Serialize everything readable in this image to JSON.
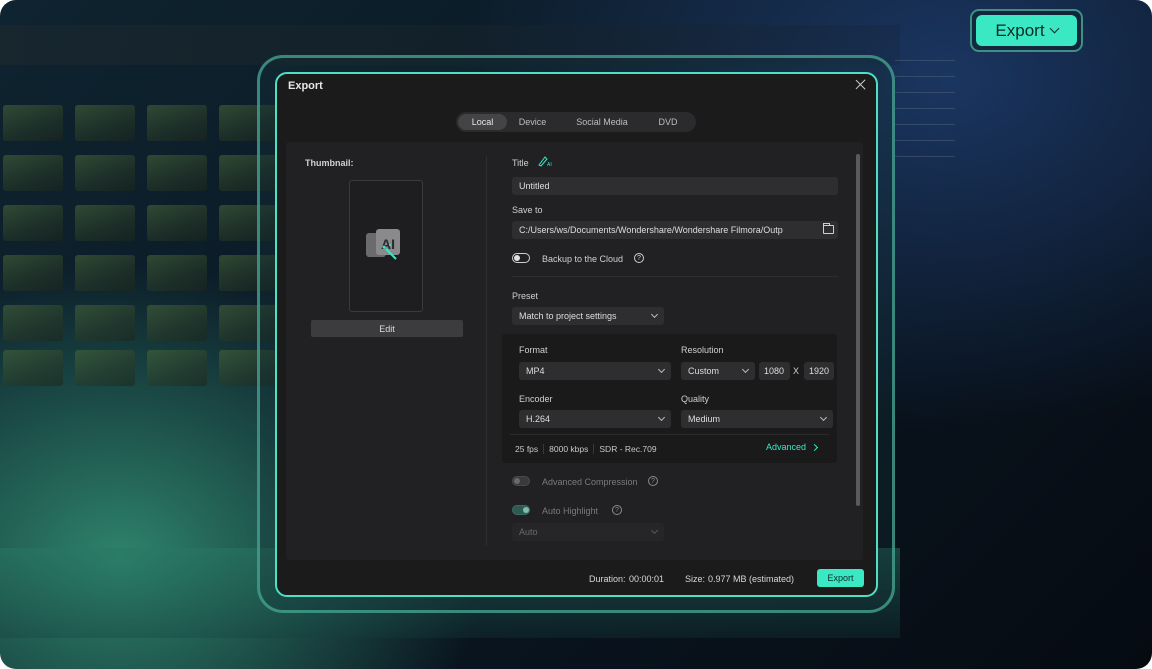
{
  "top_export_label": "Export",
  "dialog": {
    "title": "Export",
    "tabs": [
      {
        "label": "Local",
        "active": true
      },
      {
        "label": "Device",
        "active": false
      },
      {
        "label": "Social Media",
        "active": false
      },
      {
        "label": "DVD",
        "active": false
      }
    ],
    "thumbnail_label": "Thumbnail:",
    "edit_label": "Edit",
    "title_label": "Title",
    "title_value": "Untitled",
    "save_to_label": "Save to",
    "save_path": "C:/Users/ws/Documents/Wondershare/Wondershare Filmora/Outp",
    "backup_label": "Backup to the Cloud",
    "preset_label": "Preset",
    "preset_value": "Match to project settings",
    "format_label": "Format",
    "format_value": "MP4",
    "resolution_label": "Resolution",
    "resolution_value": "Custom",
    "res_width": "1080",
    "res_x": "X",
    "res_height": "1920",
    "encoder_label": "Encoder",
    "encoder_value": "H.264",
    "quality_label": "Quality",
    "quality_value": "Medium",
    "stats": [
      "25 fps",
      "8000 kbps",
      "SDR - Rec.709"
    ],
    "advanced_label": "Advanced",
    "advanced_compression_label": "Advanced Compression",
    "auto_highlight_label": "Auto Highlight",
    "auto_value": "Auto",
    "duration_label": "Duration:",
    "duration_value": "00:00:01",
    "size_label": "Size:",
    "size_value": "0.977 MB (estimated)",
    "export_label": "Export",
    "help_glyph": "?"
  },
  "colors": {
    "accent": "#3be8c4",
    "dialog_bg": "#1b1b1c",
    "panel_bg": "#212123"
  },
  "icons": [
    "close-icon",
    "chevron-down-icon",
    "folder-icon",
    "help-icon",
    "ai-pencil-icon",
    "chevron-right-icon",
    "ai-thumbnail-icon"
  ]
}
